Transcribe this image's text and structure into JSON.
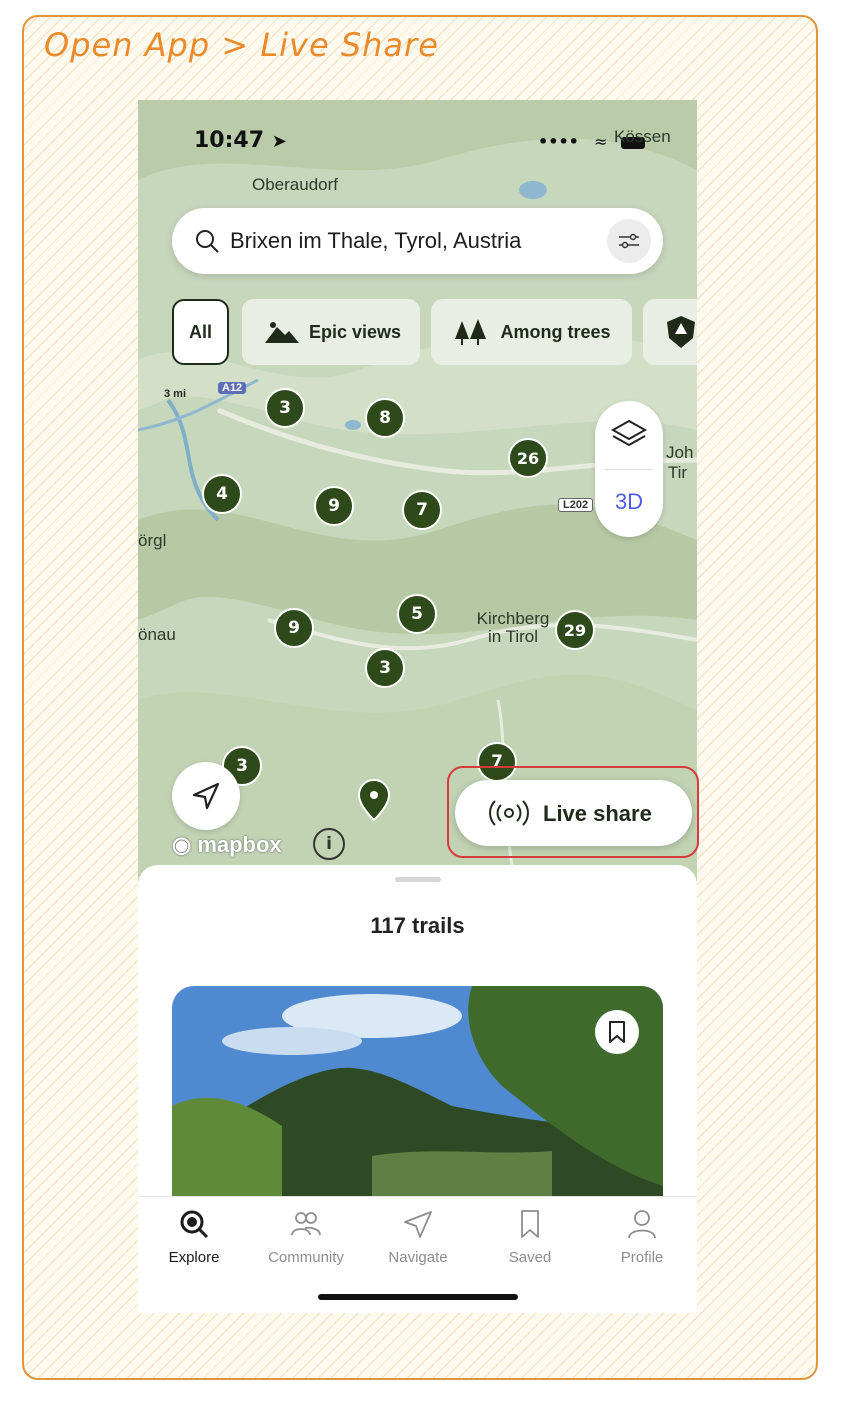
{
  "annotation": {
    "title": "Open App > Live Share"
  },
  "status_bar": {
    "time": "10:47",
    "signal": "••••"
  },
  "map": {
    "labels": {
      "kossen": "Kössen",
      "oberaudorf": "Oberaudorf",
      "worgl": "örgl",
      "onau": "önau",
      "kirchberg": "Kirchberg\nin Tirol",
      "joh": "Joh",
      "tir": "n Tir"
    },
    "road_tags": {
      "a12": "A12",
      "l202": "L202"
    },
    "scale": "3 mi",
    "clusters": [
      "3",
      "8",
      "26",
      "4",
      "9",
      "7",
      "5",
      "9",
      "3",
      "29",
      "3",
      "7"
    ],
    "attribution": "mapbox",
    "controls": {
      "mode_3d": "3D"
    }
  },
  "search": {
    "value": "Brixen im Thale, Tyrol, Austria"
  },
  "chips": [
    "All",
    "Epic views",
    "Among trees"
  ],
  "live_share": {
    "label": "Live share"
  },
  "sheet": {
    "count_label": "117 trails"
  },
  "tabs": [
    {
      "label": "Explore",
      "icon": "search-icon",
      "active": true
    },
    {
      "label": "Community",
      "icon": "community-icon",
      "active": false
    },
    {
      "label": "Navigate",
      "icon": "navigate-icon",
      "active": false
    },
    {
      "label": "Saved",
      "icon": "bookmark-icon",
      "active": false
    },
    {
      "label": "Profile",
      "icon": "profile-icon",
      "active": false
    }
  ],
  "colors": {
    "brand": "#2f4a1a",
    "annotation": "#ea8a2a",
    "highlight": "#d63a3a",
    "accent_3d": "#4b5de4"
  }
}
